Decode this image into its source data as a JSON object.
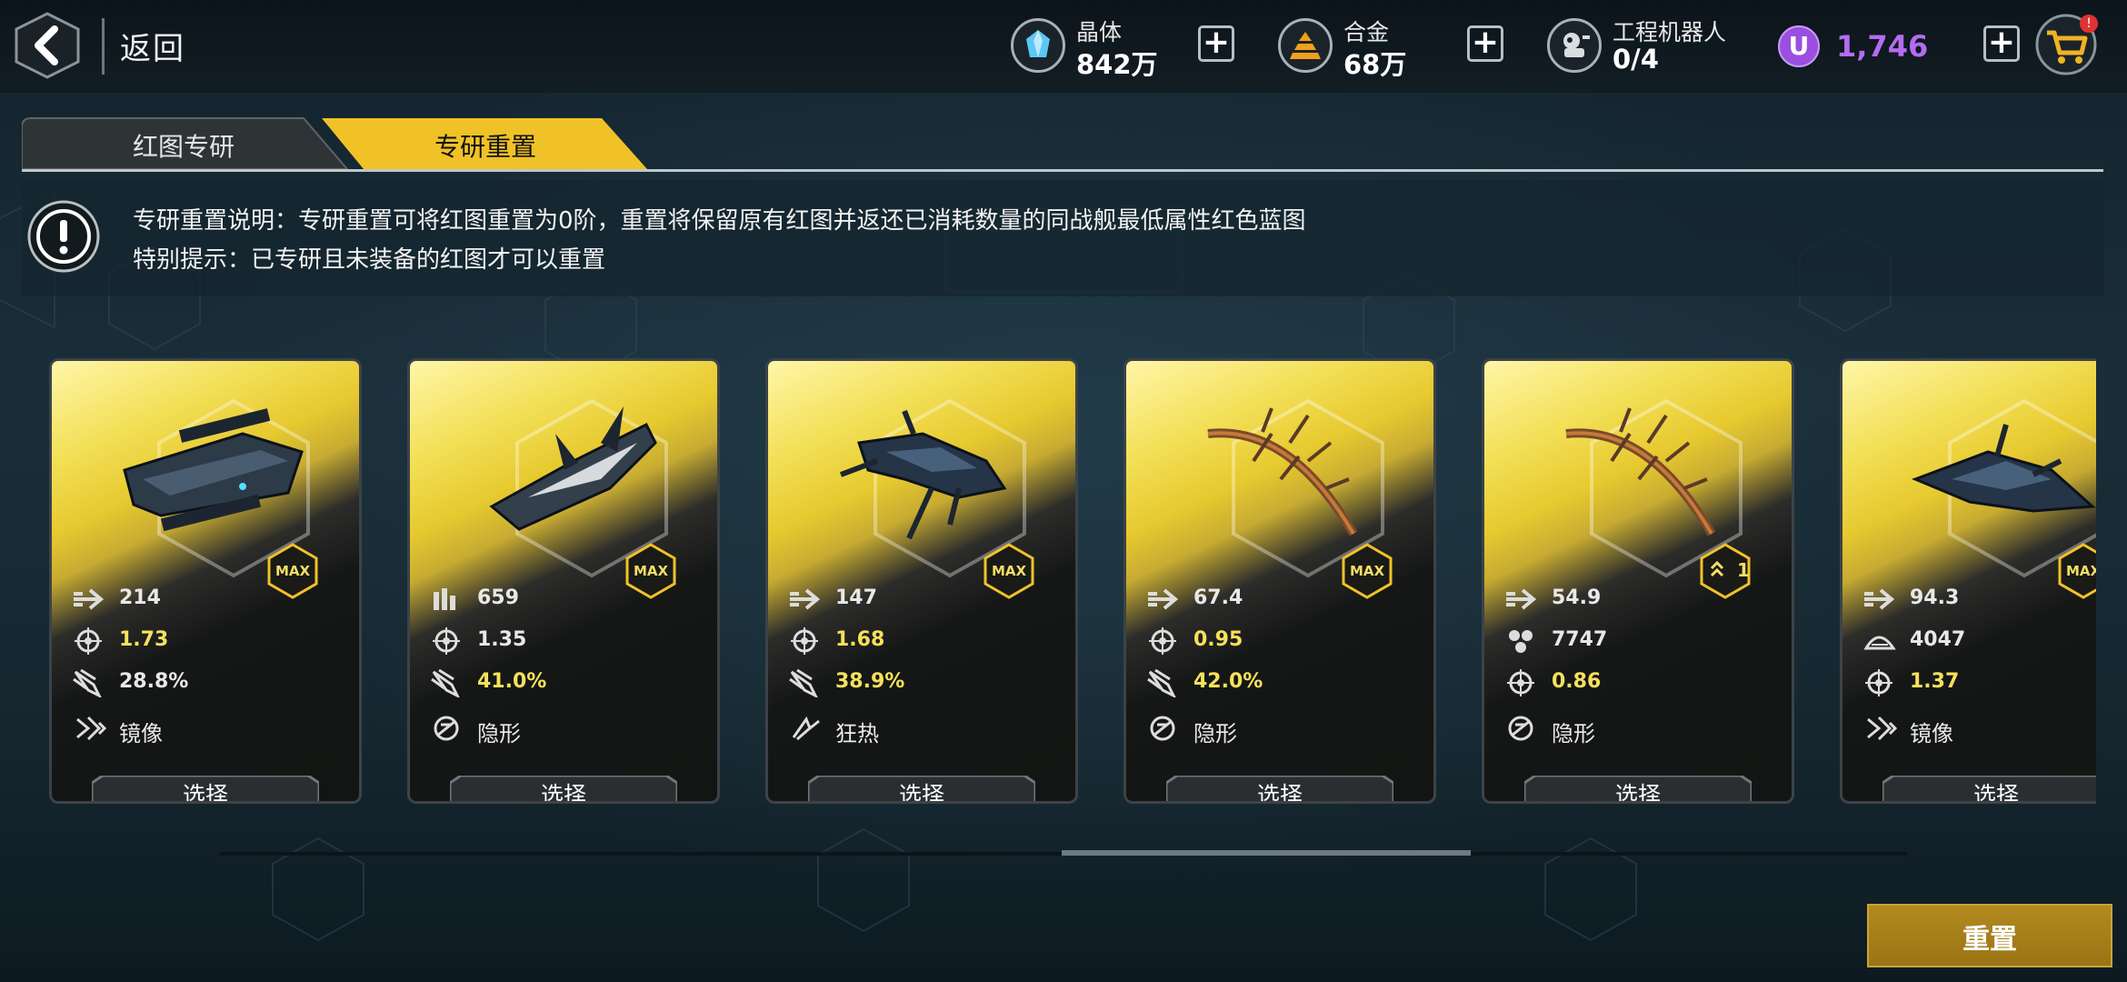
{
  "header": {
    "back_label": "返回",
    "resources": [
      {
        "label": "晶体",
        "value": "842万",
        "icon": "crystal-icon"
      },
      {
        "label": "合金",
        "value": "68万",
        "icon": "alloy-icon"
      },
      {
        "label": "工程机器人",
        "value": "0/4",
        "icon": "robot-icon"
      }
    ],
    "u_currency": "1,746",
    "u_symbol": "U",
    "cart_badge": "!"
  },
  "tabs": [
    {
      "label": "红图专研",
      "active": false
    },
    {
      "label": "专研重置",
      "active": true
    }
  ],
  "notice": {
    "line1": "专研重置说明：专研重置可将红图重置为0阶，重置将保留原有红图并返还已消耗数量的同战舰最低属性红色蓝图",
    "line2": "特别提示：已专研且未装备的红图才可以重置"
  },
  "cards": [
    {
      "badge": "MAX",
      "stats": [
        {
          "icon": "speed-arrow-icon",
          "value": "214",
          "color": "white"
        },
        {
          "icon": "crosshair-icon",
          "value": "1.73",
          "color": "yellow"
        },
        {
          "icon": "missile-icon",
          "value": "28.8%",
          "color": "white"
        }
      ],
      "skill": {
        "icon": "mirror-skill-icon",
        "label": "镜像"
      },
      "button": "选择"
    },
    {
      "badge": "MAX",
      "stats": [
        {
          "icon": "ammo-icon",
          "value": "659",
          "color": "white"
        },
        {
          "icon": "crosshair-icon",
          "value": "1.35",
          "color": "white"
        },
        {
          "icon": "missile-icon",
          "value": "41.0%",
          "color": "yellow"
        }
      ],
      "skill": {
        "icon": "stealth-skill-icon",
        "label": "隐形"
      },
      "button": "选择"
    },
    {
      "badge": "MAX",
      "stats": [
        {
          "icon": "speed-arrow-icon",
          "value": "147",
          "color": "white"
        },
        {
          "icon": "crosshair-icon",
          "value": "1.68",
          "color": "yellow"
        },
        {
          "icon": "missile-icon",
          "value": "38.9%",
          "color": "yellow"
        }
      ],
      "skill": {
        "icon": "frenzy-skill-icon",
        "label": "狂热"
      },
      "button": "选择"
    },
    {
      "badge": "MAX",
      "stats": [
        {
          "icon": "speed-arrow-icon",
          "value": "67.4",
          "color": "white"
        },
        {
          "icon": "crosshair-icon",
          "value": "0.95",
          "color": "yellow"
        },
        {
          "icon": "missile-icon",
          "value": "42.0%",
          "color": "yellow"
        }
      ],
      "skill": {
        "icon": "stealth-skill-icon",
        "label": "隐形"
      },
      "button": "选择"
    },
    {
      "badge": "1",
      "stats": [
        {
          "icon": "speed-arrow-icon",
          "value": "54.9",
          "color": "white"
        },
        {
          "icon": "cluster-icon",
          "value": "7747",
          "color": "white"
        },
        {
          "icon": "crosshair-icon",
          "value": "0.86",
          "color": "yellow"
        }
      ],
      "skill": {
        "icon": "stealth-skill-icon",
        "label": "隐形"
      },
      "button": "选择"
    },
    {
      "badge": "MAX",
      "stats": [
        {
          "icon": "speed-arrow-icon",
          "value": "94.3",
          "color": "white"
        },
        {
          "icon": "shield-arc-icon",
          "value": "4047",
          "color": "white"
        },
        {
          "icon": "crosshair-icon",
          "value": "1.37",
          "color": "yellow"
        }
      ],
      "skill": {
        "icon": "mirror-skill-icon",
        "label": "镜像"
      },
      "button": "选择"
    }
  ],
  "reset_button": "重置",
  "colors": {
    "accent": "#f0c228",
    "u_purple": "#b46cf1",
    "stat_yellow": "#f7e15b"
  }
}
